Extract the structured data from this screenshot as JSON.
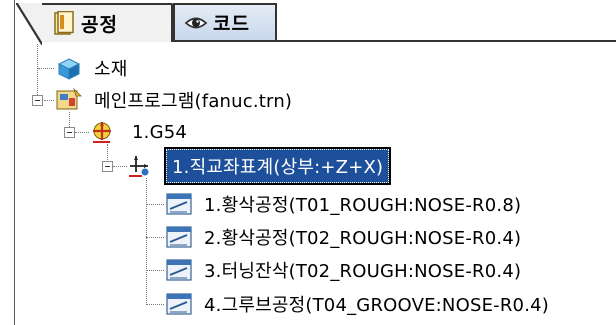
{
  "tabs": [
    {
      "label": "공정",
      "icon": "process-sheet-icon",
      "active": true
    },
    {
      "label": "코드",
      "icon": "eye-icon",
      "active": false
    }
  ],
  "tree": {
    "material": {
      "label": "소재",
      "icon": "material-cube-icon"
    },
    "main_program": {
      "label": "메인프로그램(fanuc.trn)",
      "icon": "program-icon"
    },
    "wcs": {
      "label": "1.G54",
      "icon": "coordinate-system-icon"
    },
    "coordinate": {
      "label": "1.직교좌표계(상부:+Z+X)",
      "icon": "axis-icon",
      "selected": true
    },
    "operations": [
      {
        "label": "1.황삭공정(T01_ROUGH:NOSE-R0.8)",
        "icon": "operation-icon"
      },
      {
        "label": "2.황삭공정(T02_ROUGH:NOSE-R0.4)",
        "icon": "operation-icon"
      },
      {
        "label": "3.터닝잔삭(T02_ROUGH:NOSE-R0.4)",
        "icon": "operation-icon"
      },
      {
        "label": "4.그루브공정(T04_GROOVE:NOSE-R0.4)",
        "icon": "operation-icon"
      }
    ]
  },
  "colors": {
    "selection": "#1d4f9a",
    "tab_active": "#f1f1f1",
    "tab_inactive": "#c9d8ec"
  }
}
